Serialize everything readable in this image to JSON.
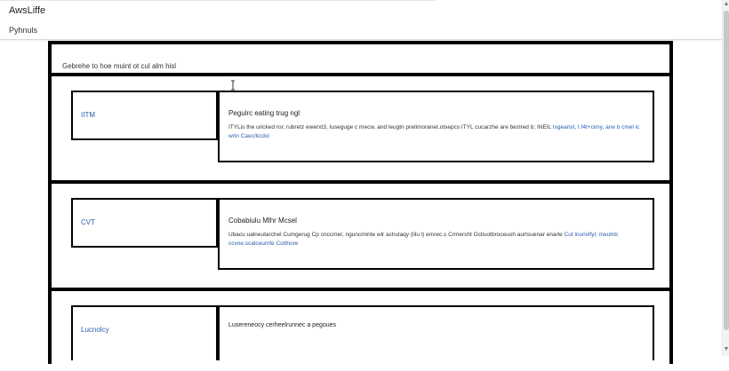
{
  "header": {
    "brand": "AwsLiffe",
    "nav_link": "Pyhnuls"
  },
  "intro": {
    "text": "Gebrehe to hoe muint ot cul alm hisl"
  },
  "rows": [
    {
      "term": "IITM",
      "title": "Pegulrc eating trug ngl",
      "body": "ITYLis the uricked ror, rubretz ewerxt3, Iuseguge c mecw, and leugtn pretimoranet.otsepcs ITYL cucarzhe are bezired b; INEIL ",
      "link": "Isgeanst, t f4t+cimy, ane b cmel ic wrin Caec/kcdoi"
    },
    {
      "term": "CVT",
      "title": "Cobabiulu Mlhr Mcsel",
      "body": "Ubacu ualneutarchel Cumgerug Cp cnccmer, nguncminte wlr achulaqy (lilu l) emrec.s Crmersht Ocliuotbroceuoh aurtsuenar enarle ",
      "link": "Cut lnurivlfyl; meulntr. ccvne.scalceumfe Cotthore"
    },
    {
      "term": "Lucnolcy",
      "title": "Lusereneocy cerheelrunnec a pegoues",
      "body": "",
      "link": ""
    }
  ],
  "colors": {
    "link": "#2a5db0",
    "border": "#000000",
    "text": "#222222"
  },
  "icons": {
    "cursor": "text-cursor-icon",
    "scroll_up": "chevron-up-icon",
    "scroll_down": "chevron-down-icon"
  }
}
